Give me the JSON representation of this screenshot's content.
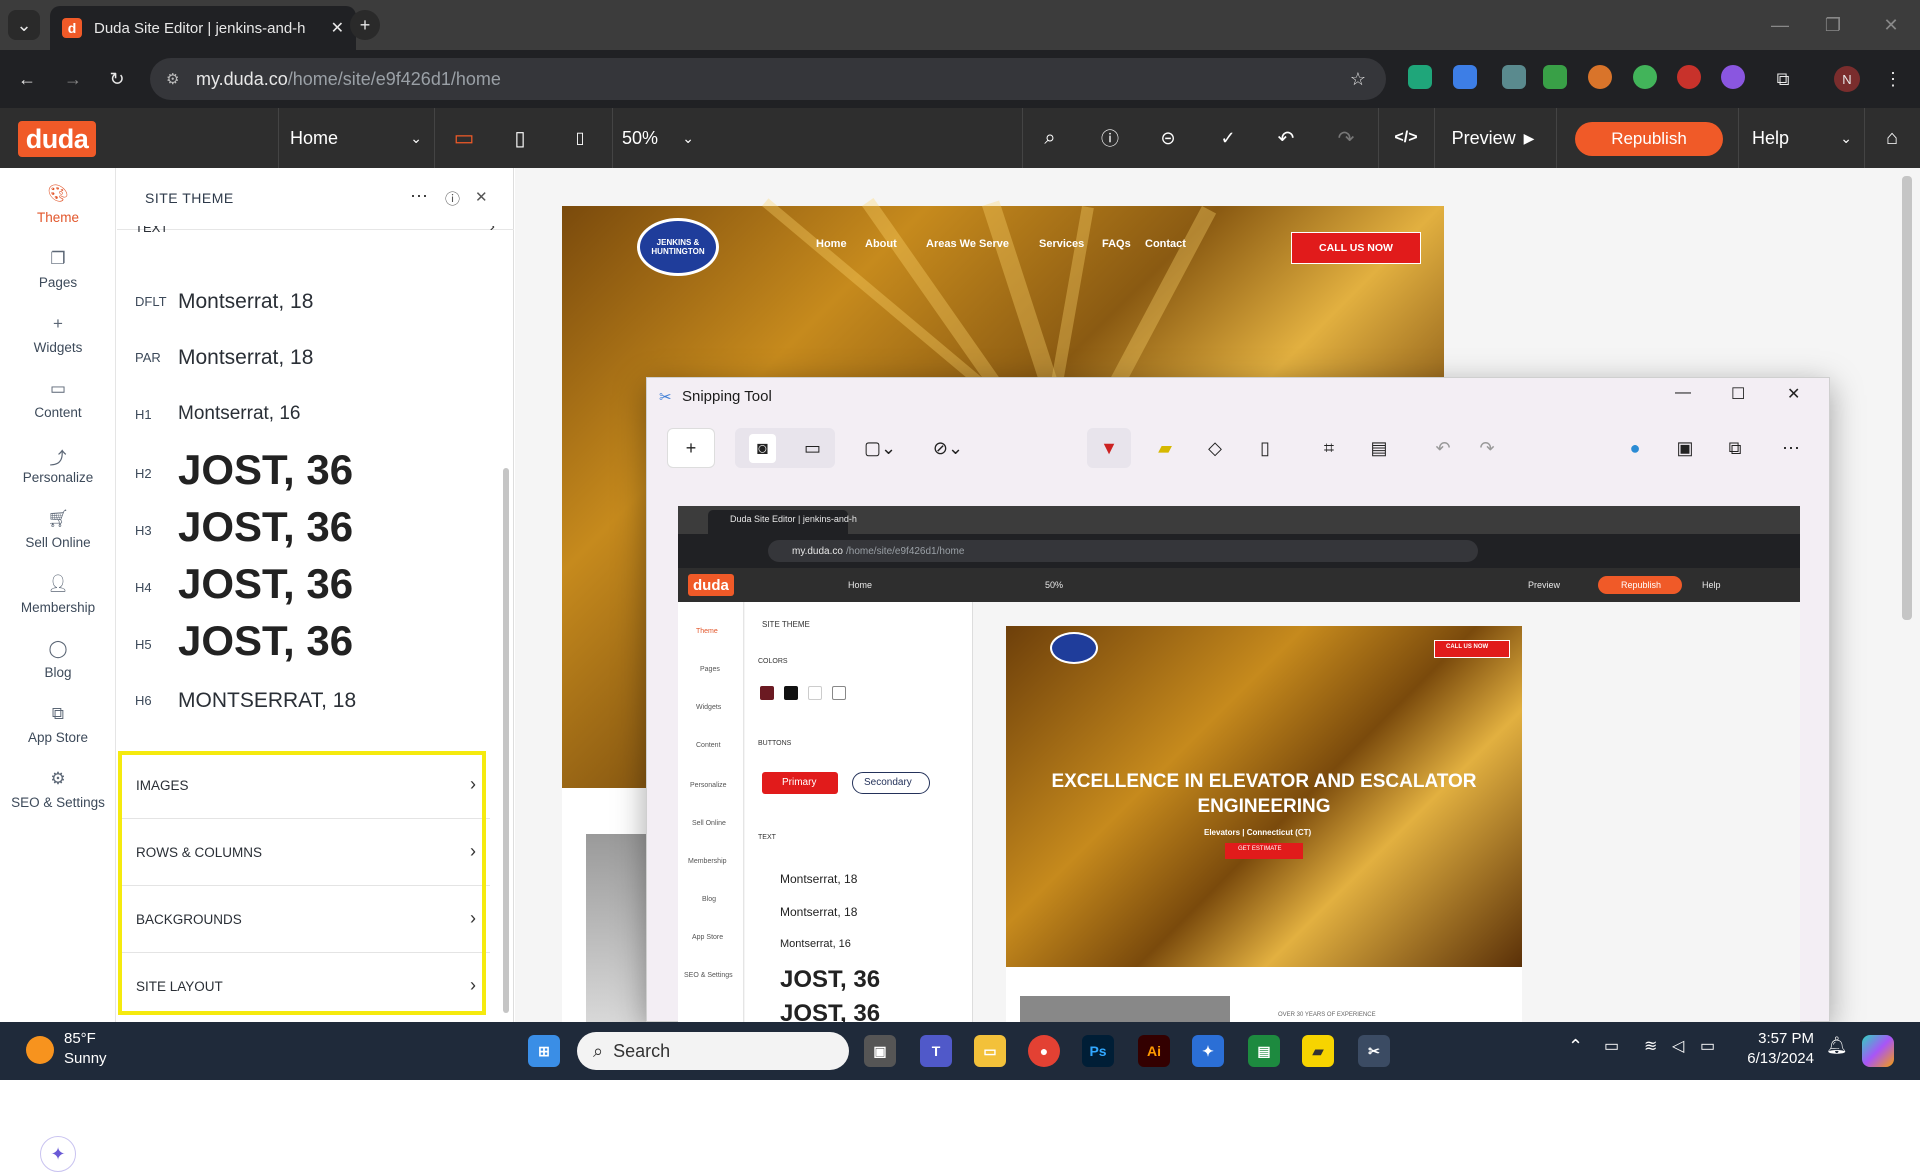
{
  "browser": {
    "tab_title": "Duda Site Editor | jenkins-and-h",
    "url_host": "my.duda.co",
    "url_path": "/home/site/e9f426d1/home"
  },
  "editor": {
    "logo": "duda",
    "page_selector": "Home",
    "zoom": "50%",
    "preview": "Preview",
    "republish": "Republish",
    "help": "Help"
  },
  "leftnav": {
    "items": [
      {
        "label": "Theme"
      },
      {
        "label": "Pages"
      },
      {
        "label": "Widgets"
      },
      {
        "label": "Content"
      },
      {
        "label": "Personalize"
      },
      {
        "label": "Sell Online"
      },
      {
        "label": "Membership"
      },
      {
        "label": "Blog"
      },
      {
        "label": "App Store"
      },
      {
        "label": "SEO & Settings"
      }
    ]
  },
  "panel": {
    "title": "SITE THEME",
    "text_section": "TEXT",
    "typography": [
      {
        "tag": "DFLT",
        "value": "Montserrat, 18"
      },
      {
        "tag": "PAR",
        "value": "Montserrat, 18"
      },
      {
        "tag": "H1",
        "value": "Montserrat, 16"
      },
      {
        "tag": "H2",
        "value": "JOST, 36"
      },
      {
        "tag": "H3",
        "value": "JOST, 36"
      },
      {
        "tag": "H4",
        "value": "JOST, 36"
      },
      {
        "tag": "H5",
        "value": "JOST, 36"
      },
      {
        "tag": "H6",
        "value": "MONTSERRAT, 18"
      }
    ],
    "sections": [
      {
        "label": "IMAGES"
      },
      {
        "label": "ROWS & COLUMNS"
      },
      {
        "label": "BACKGROUNDS"
      },
      {
        "label": "SITE LAYOUT"
      }
    ]
  },
  "site": {
    "logo_text": "JENKINS & HUNTINGTON",
    "nav": [
      "Home",
      "About",
      "Areas We Serve",
      "Services",
      "FAQs",
      "Contact"
    ],
    "cta": "CALL US NOW"
  },
  "snipping": {
    "title": "Snipping Tool",
    "mini": {
      "tab_title": "Duda Site Editor | jenkins-and-h",
      "url_host": "my.duda.co",
      "url_path": "/home/site/e9f426d1/home",
      "logo": "duda",
      "page": "Home",
      "zoom": "50%",
      "preview": "Preview",
      "republish": "Republish",
      "help": "Help",
      "panel_title": "SITE THEME",
      "colors": "COLORS",
      "buttons": "BUTTONS",
      "primary": "Primary",
      "secondary": "Secondary",
      "text": "TEXT",
      "t1": "Montserrat, 18",
      "t2": "Montserrat, 18",
      "t3": "Montserrat, 16",
      "t4": "JOST, 36",
      "t5": "JOST, 36",
      "hero_title": "EXCELLENCE IN ELEVATOR AND ESCALATOR ENGINEERING",
      "hero_sub": "Elevators | Connecticut (CT)",
      "hero_btn": "GET ESTIMATE",
      "cta": "CALL US NOW",
      "experience": "OVER 30 YEARS OF EXPERIENCE",
      "nav": [
        "Theme",
        "Pages",
        "Widgets",
        "Content",
        "Personalize",
        "Sell Online",
        "Membership",
        "Blog",
        "App Store",
        "SEO & Settings"
      ]
    }
  },
  "taskbar": {
    "temp": "85°F",
    "weather": "Sunny",
    "search": "Search",
    "time": "3:57 PM",
    "date": "6/13/2024",
    "avatar": "N"
  },
  "colors": {
    "accent": "#f05a28",
    "highlight": "#f5ea0e",
    "cta_red": "#e11b1b"
  }
}
